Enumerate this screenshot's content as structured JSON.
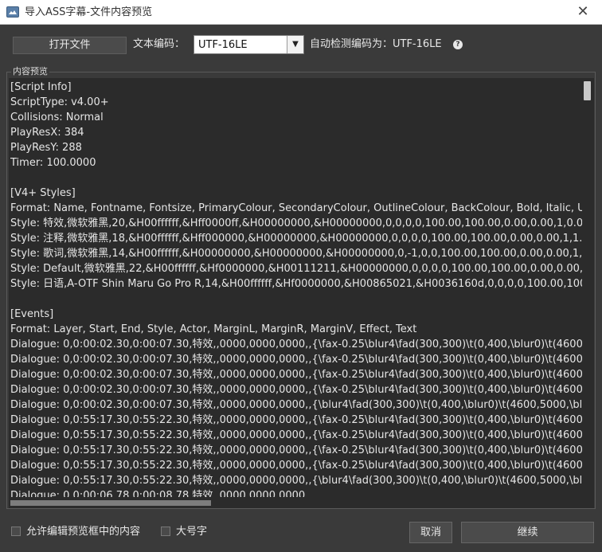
{
  "window": {
    "title": "导入ASS字幕-文件内容预览",
    "close_glyph": "✕"
  },
  "toolbar": {
    "open_file_label": "打开文件",
    "encoding_label": "文本编码：",
    "encoding_value": "UTF-16LE",
    "auto_detect_label": "自动检测编码为：UTF-16LE",
    "help_glyph": "?"
  },
  "preview": {
    "group_title": "内容预览",
    "lines": [
      "[Script Info]",
      "ScriptType: v4.00+",
      "Collisions: Normal",
      "PlayResX: 384",
      "PlayResY: 288",
      "Timer: 100.0000",
      "",
      "[V4+ Styles]",
      "Format: Name, Fontname, Fontsize, PrimaryColour, SecondaryColour, OutlineColour, BackColour, Bold, Italic, Und",
      "Style: 特效,微软雅黑,20,&H00ffffff,&Hff0000ff,&H00000000,&H00000000,0,0,0,0,100.00,100.00,0.00,0.00,1,0.00,0",
      "Style: 注释,微软雅黑,18,&H00ffffff,&Hff000000,&H00000000,&H00000000,0,0,0,0,100.00,100.00,0.00,0.00,1,1.50,0",
      "Style: 歌词,微软雅黑,14,&H00ffffff,&H00000000,&H00000000,&H00000000,0,-1,0,0,100.00,100.00,0.00,0.00,1,1.0",
      "Style: Default,微软雅黑,22,&H00ffffff,&Hf0000000,&H00111211,&H00000000,0,0,0,0,100.00,100.00,0.00,0.00,1,1.",
      "Style: 日语,A-OTF Shin Maru Go Pro R,14,&H00ffffff,&Hf0000000,&H00865021,&H0036160d,0,0,0,0,100.00,100.0",
      "",
      "[Events]",
      "Format: Layer, Start, End, Style, Actor, MarginL, MarginR, MarginV, Effect, Text",
      "Dialogue: 0,0:00:02.30,0:00:07.30,特效,,0000,0000,0000,,{\\fax-0.25\\blur4\\fad(300,300)\\t(0,400,\\blur0)\\t(4600,500",
      "Dialogue: 0,0:00:02.30,0:00:07.30,特效,,0000,0000,0000,,{\\fax-0.25\\blur4\\fad(300,300)\\t(0,400,\\blur0)\\t(4600,500",
      "Dialogue: 0,0:00:02.30,0:00:07.30,特效,,0000,0000,0000,,{\\fax-0.25\\blur4\\fad(300,300)\\t(0,400,\\blur0)\\t(4600,500",
      "Dialogue: 0,0:00:02.30,0:00:07.30,特效,,0000,0000,0000,,{\\fax-0.25\\blur4\\fad(300,300)\\t(0,400,\\blur0)\\t(4600,500",
      "Dialogue: 0,0:00:02.30,0:00:07.30,特效,,0000,0000,0000,,{\\blur4\\fad(300,300)\\t(0,400,\\blur0)\\t(4600,5000,\\blur4)}",
      "Dialogue: 0,0:55:17.30,0:55:22.30,特效,,0000,0000,0000,,{\\fax-0.25\\blur4\\fad(300,300)\\t(0,400,\\blur0)\\t(4600,500",
      "Dialogue: 0,0:55:17.30,0:55:22.30,特效,,0000,0000,0000,,{\\fax-0.25\\blur4\\fad(300,300)\\t(0,400,\\blur0)\\t(4600,500",
      "Dialogue: 0,0:55:17.30,0:55:22.30,特效,,0000,0000,0000,,{\\fax-0.25\\blur4\\fad(300,300)\\t(0,400,\\blur0)\\t(4600,500",
      "Dialogue: 0,0:55:17.30,0:55:22.30,特效,,0000,0000,0000,,{\\fax-0.25\\blur4\\fad(300,300)\\t(0,400,\\blur0)\\t(4600,500",
      "Dialogue: 0,0:55:17.30,0:55:22.30,特效,,0000,0000,0000,,{\\blur4\\fad(300,300)\\t(0,400,\\blur0)\\t(4600,5000,\\blur4)}",
      "Dialogue: 0,0:00:06.78,0:00:08.78,特效,,0000,0000,0000,,"
    ]
  },
  "footer": {
    "allow_edit_label": "允许编辑预览框中的内容",
    "allow_edit_checked": false,
    "large_font_label": "大号字",
    "large_font_checked": false,
    "cancel_label": "取消",
    "continue_label": "继续"
  },
  "colors": {
    "background": "#3a3a3a",
    "preview_background": "#2b2b2b",
    "text": "#e8e8e8"
  }
}
